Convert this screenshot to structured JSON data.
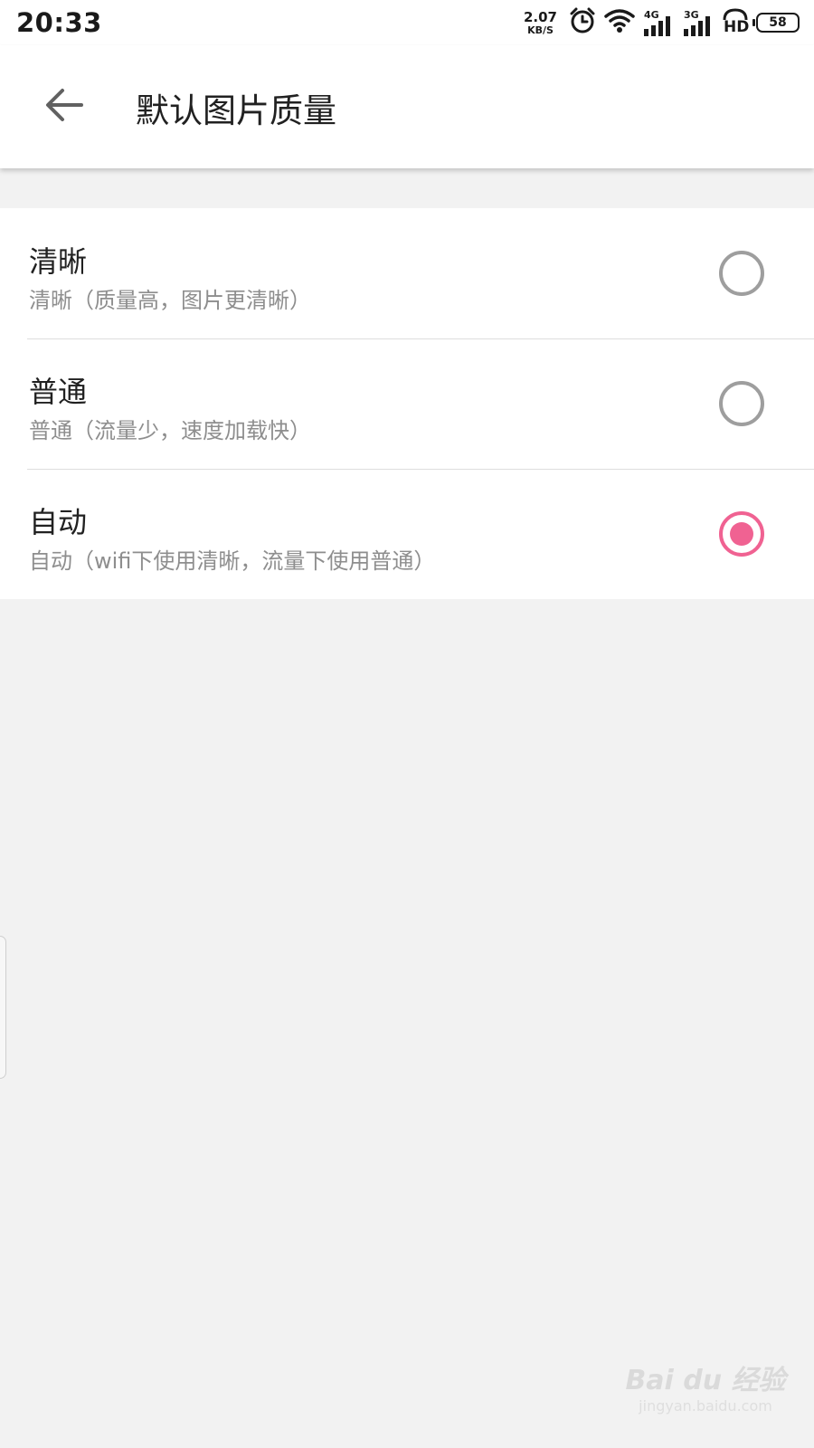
{
  "status_bar": {
    "time": "20:33",
    "net_speed_value": "2.07",
    "net_speed_unit": "KB/S",
    "sim1_type": "4G",
    "sim2_type": "3G",
    "hd_label": "HD",
    "battery_level": "58"
  },
  "app_bar": {
    "title": "默认图片质量",
    "back_icon": "arrow-back-icon"
  },
  "options": [
    {
      "title": "清晰",
      "description": "清晰（质量高，图片更清晰）",
      "selected": false
    },
    {
      "title": "普通",
      "description": "普通（流量少，速度加载快）",
      "selected": false
    },
    {
      "title": "自动",
      "description": "自动（wifi下使用清晰，流量下使用普通）",
      "selected": true
    }
  ],
  "watermark": {
    "brand": "Bai du 经验",
    "url": "jingyan.baidu.com"
  },
  "colors": {
    "accent": "#f06292",
    "radio_unselected": "#9e9e9e",
    "background": "#f2f2f2"
  }
}
